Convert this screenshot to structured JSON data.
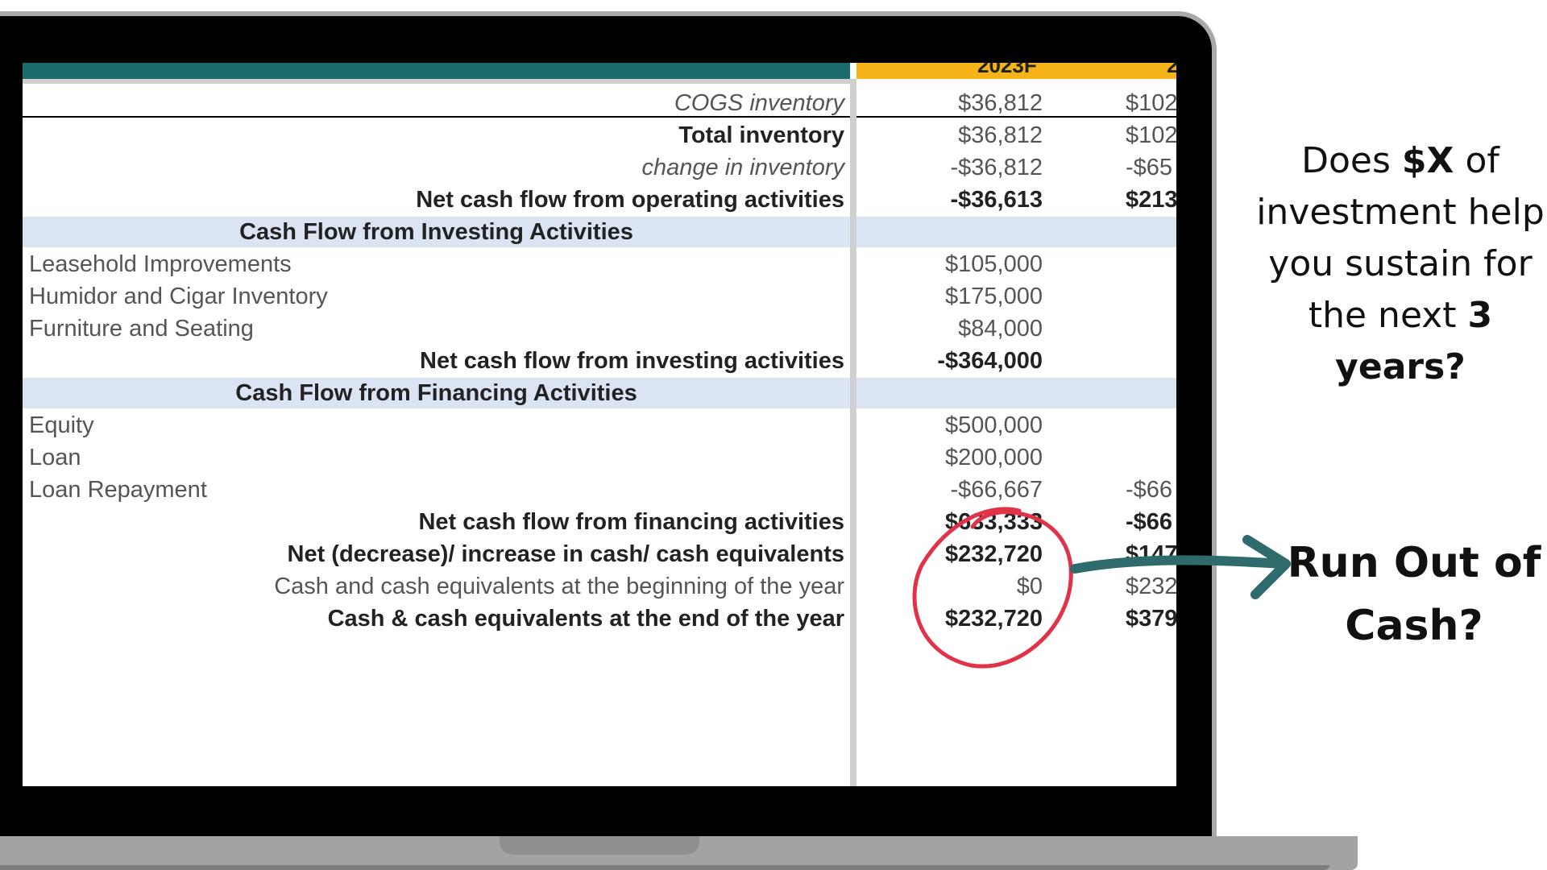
{
  "table": {
    "header": {
      "year1": "2023F",
      "year2": "2"
    },
    "rows": [
      {
        "label": "COGS inventory",
        "v1": "$36,812",
        "v2": "$102"
      },
      {
        "label": "Total inventory",
        "v1": "$36,812",
        "v2": "$102"
      },
      {
        "label": "change in inventory",
        "v1": "-$36,812",
        "v2": "-$65"
      },
      {
        "label": "Net cash flow from operating activities",
        "v1": "-$36,613",
        "v2": "$213"
      },
      {
        "label": "Cash Flow from Investing Activities"
      },
      {
        "label": "Leasehold Improvements",
        "v1": "$105,000",
        "v2": ""
      },
      {
        "label": "Humidor and Cigar Inventory",
        "v1": "$175,000",
        "v2": ""
      },
      {
        "label": "Furniture and Seating",
        "v1": "$84,000",
        "v2": ""
      },
      {
        "label": "Net cash flow from investing activities",
        "v1": "-$364,000",
        "v2": ""
      },
      {
        "label": "Cash Flow from Financing Activities"
      },
      {
        "label": "Equity",
        "v1": "$500,000",
        "v2": ""
      },
      {
        "label": "Loan",
        "v1": "$200,000",
        "v2": ""
      },
      {
        "label": "Loan Repayment",
        "v1": "-$66,667",
        "v2": "-$66"
      },
      {
        "label": "Net cash flow from financing activities",
        "v1": "$633,333",
        "v2": "-$66"
      },
      {
        "label": "Net (decrease)/ increase in cash/ cash equivalents",
        "v1": "$232,720",
        "v2": "$147"
      },
      {
        "label": "Cash and cash equivalents at the beginning of the year",
        "v1": "$0",
        "v2": "$232"
      },
      {
        "label": "Cash & cash equivalents at the end of the year",
        "v1": "$232,720",
        "v2": "$379"
      }
    ]
  },
  "annotation": {
    "question_part1": "Does ",
    "question_bold1": "$X",
    "question_part2": " of investment help you sustain for the next ",
    "question_bold2": "3 years?",
    "callout_line1": "Run Out of",
    "callout_line2": "Cash?",
    "circle_color": "#e0334a",
    "arrow_color": "#2f6b6d"
  }
}
